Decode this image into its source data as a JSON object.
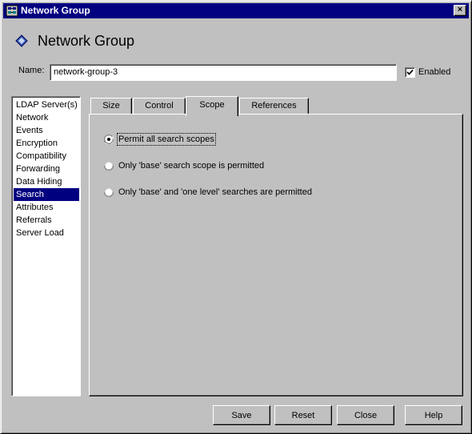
{
  "window": {
    "title": "Network Group",
    "icon": "network-group-icon",
    "close_glyph": "×"
  },
  "header": {
    "title": "Network Group",
    "icon": "diamond-bullet-icon",
    "accent_color": "#000080"
  },
  "name_field": {
    "label": "Name:",
    "value": "network-group-3"
  },
  "enabled": {
    "label": "Enabled",
    "checked": true
  },
  "sidebar": {
    "items": [
      {
        "label": "LDAP Server(s)",
        "selected": false
      },
      {
        "label": "Network",
        "selected": false
      },
      {
        "label": "Events",
        "selected": false
      },
      {
        "label": "Encryption",
        "selected": false
      },
      {
        "label": "Compatibility",
        "selected": false
      },
      {
        "label": "Forwarding",
        "selected": false
      },
      {
        "label": "Data Hiding",
        "selected": false
      },
      {
        "label": "Search",
        "selected": true
      },
      {
        "label": "Attributes",
        "selected": false
      },
      {
        "label": "Referrals",
        "selected": false
      },
      {
        "label": "Server Load",
        "selected": false
      }
    ]
  },
  "tabs": [
    {
      "label": "Size",
      "active": false
    },
    {
      "label": "Control",
      "active": false
    },
    {
      "label": "Scope",
      "active": true
    },
    {
      "label": "References",
      "active": false
    }
  ],
  "scope": {
    "options": [
      {
        "label": "Permit all search scopes",
        "selected": true
      },
      {
        "label": "Only 'base' search scope is permitted",
        "selected": false
      },
      {
        "label": "Only 'base' and 'one level' searches are permitted",
        "selected": false
      }
    ]
  },
  "buttons": {
    "save": "Save",
    "reset": "Reset",
    "close": "Close",
    "help": "Help"
  }
}
